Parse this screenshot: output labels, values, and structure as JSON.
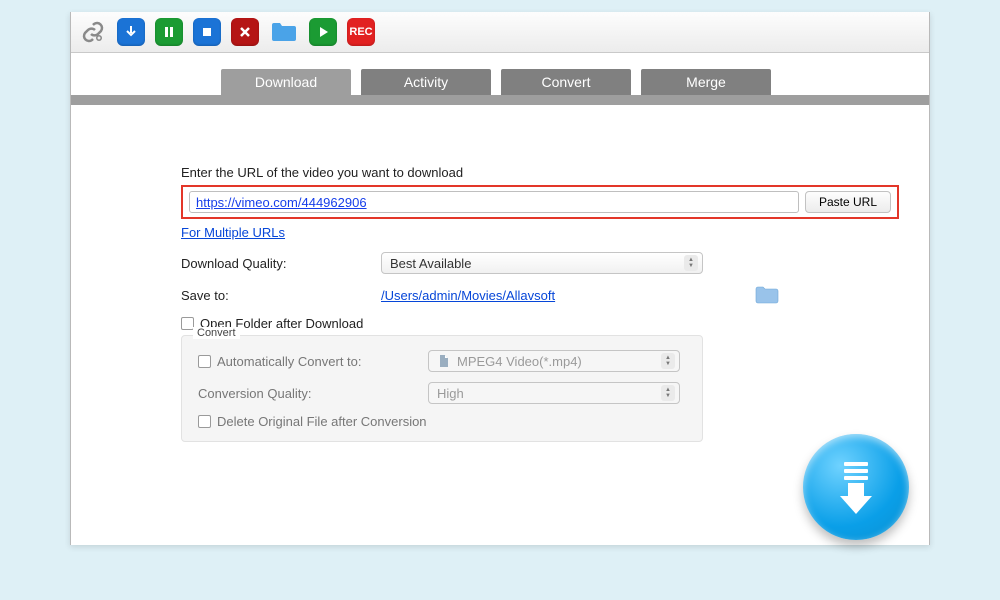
{
  "toolbar_icons": {
    "link": "link-icon",
    "download": "download-icon",
    "pause": "pause-icon",
    "stop": "stop-icon",
    "close": "close-icon",
    "folder": "folder-icon",
    "play": "play-icon",
    "record": "REC"
  },
  "tabs": {
    "download": "Download",
    "activity": "Activity",
    "convert": "Convert",
    "merge": "Merge"
  },
  "main": {
    "url_label": "Enter the URL of the video you want to download",
    "url_value": "https://vimeo.com/444962906",
    "paste_button": "Paste URL",
    "multiple_link": "For Multiple URLs",
    "quality_label": "Download Quality:",
    "quality_value": "Best Available",
    "save_to_label": "Save to:",
    "save_to_path": "/Users/admin/Movies/Allavsoft",
    "open_folder_label": "Open Folder after Download"
  },
  "convert": {
    "legend": "Convert",
    "auto_label": "Automatically Convert to:",
    "format_value": "MPEG4 Video(*.mp4)",
    "quality_label": "Conversion Quality:",
    "quality_value": "High",
    "delete_label": "Delete Original File after Conversion"
  }
}
